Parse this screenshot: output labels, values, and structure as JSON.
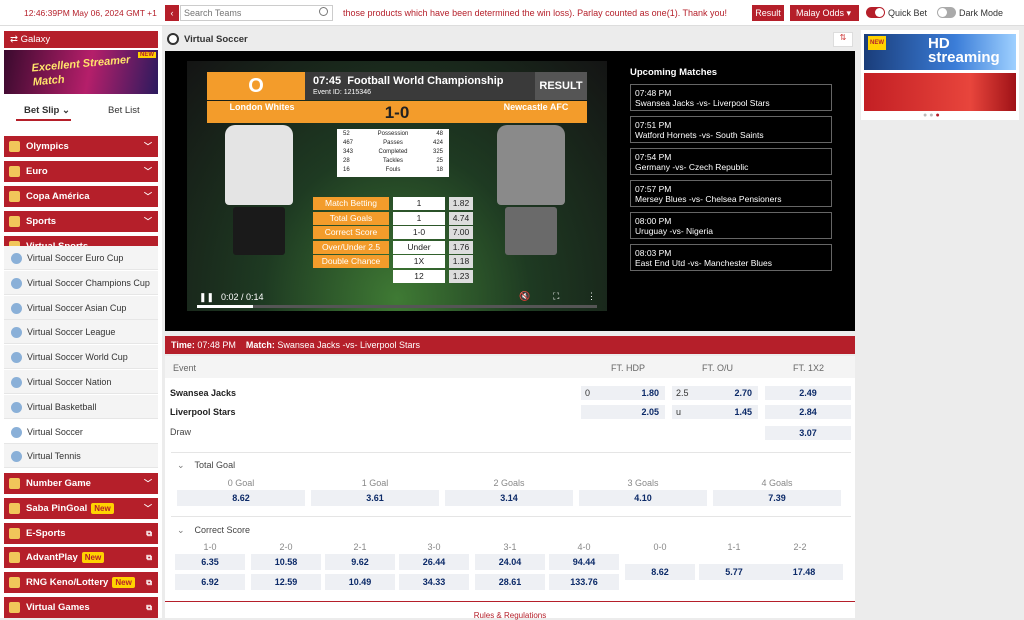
{
  "topbar": {
    "clock": "12:46:39PM May 06, 2024 GMT +1",
    "search_placeholder": "Search Teams",
    "ticker": "those products which have been determined the win loss). Parlay counted as one(1). Thank you!",
    "result_label": "Result",
    "odds_format": "Malay Odds",
    "quick_bet_label": "Quick Bet",
    "dark_mode_label": "Dark Mode",
    "accent": "#b51f2a"
  },
  "sidebar": {
    "galaxy_label": "Galaxy",
    "banner_text": "Excellent Streamer Match",
    "banner_badge": "NEW",
    "bet_slip": "Bet Slip",
    "bet_list": "Bet List",
    "menus_top": [
      {
        "label": "Olympics",
        "icon": "torch-icon"
      },
      {
        "label": "Euro",
        "icon": "trophy-icon"
      },
      {
        "label": "Copa América",
        "icon": "trophy-icon"
      },
      {
        "label": "Sports",
        "icon": "sports-icon"
      },
      {
        "label": "Virtual Sports",
        "icon": "virtual-sports-icon"
      }
    ],
    "virtual_items": [
      "Virtual Soccer Euro Cup",
      "Virtual Soccer Champions Cup",
      "Virtual Soccer Asian Cup",
      "Virtual Soccer League",
      "Virtual Soccer World Cup",
      "Virtual Soccer Nation",
      "Virtual Basketball",
      "Virtual Soccer",
      "Virtual Tennis"
    ],
    "menus_bottom": [
      {
        "label": "Number Game",
        "badge": ""
      },
      {
        "label": "Saba PinGoal",
        "badge": "New"
      },
      {
        "label": "E-Sports",
        "badge": ""
      },
      {
        "label": "AdvantPlay",
        "badge": "New"
      },
      {
        "label": "RNG Keno/Lottery",
        "badge": "New"
      },
      {
        "label": "Virtual Games",
        "badge": ""
      }
    ]
  },
  "header": {
    "title": "Virtual Soccer"
  },
  "video": {
    "logo": "O",
    "clock": "07:45",
    "competition": "Football World Championship",
    "event_id": "Event ID: 1215346",
    "result_label": "RESULT",
    "home": "London Whites",
    "away": "Newcastle AFC",
    "score": "1-0",
    "stats": [
      {
        "l": "52",
        "n": "Possession",
        "r": "48"
      },
      {
        "l": "467",
        "n": "Passes",
        "r": "424"
      },
      {
        "l": "343",
        "n": "Completed",
        "r": "325"
      },
      {
        "l": "28",
        "n": "Tackles",
        "r": "25"
      },
      {
        "l": "16",
        "n": "Fouls",
        "r": "18"
      }
    ],
    "bets": [
      {
        "label": "Match Betting",
        "v1": "1",
        "v2": "1.82"
      },
      {
        "label": "Total Goals",
        "v1": "1",
        "v2": "4.74"
      },
      {
        "label": "Correct Score",
        "v1": "1-0",
        "v2": "7.00"
      },
      {
        "label": "Over/Under 2.5",
        "v1": "Under",
        "v2": "1.76"
      },
      {
        "label": "Double Chance",
        "v1": "1X",
        "v2": "1.18"
      },
      {
        "label": "",
        "v1": "12",
        "v2": "1.23"
      }
    ],
    "time_display": "0:02 / 0:14",
    "progress": 0.14
  },
  "upcoming": {
    "title": "Upcoming Matches",
    "matches": [
      {
        "time": "07:48 PM",
        "teams": "Swansea Jacks -vs- Liverpool Stars"
      },
      {
        "time": "07:51 PM",
        "teams": "Watford Hornets -vs- South Saints"
      },
      {
        "time": "07:54 PM",
        "teams": "Germany -vs- Czech Republic"
      },
      {
        "time": "07:57 PM",
        "teams": "Mersey Blues -vs- Chelsea Pensioners"
      },
      {
        "time": "08:00 PM",
        "teams": "Uruguay -vs- Nigeria"
      },
      {
        "time": "08:03 PM",
        "teams": "East End Utd -vs- Manchester Blues"
      }
    ]
  },
  "right_banner": {
    "badge": "NEW",
    "hd_text": "HD streaming"
  },
  "match": {
    "time_label": "Time:",
    "time": "07:48 PM",
    "match_label": "Match:",
    "teams": "Swansea Jacks -vs- Liverpool Stars",
    "columns": [
      "Event",
      "FT. HDP",
      "FT. O/U",
      "FT. 1X2"
    ],
    "home": "Swansea Jacks",
    "away": "Liverpool Stars",
    "draw": "Draw",
    "hdp": {
      "line": "0",
      "home": "1.80",
      "away": "2.05"
    },
    "ou": {
      "line": "2.5",
      "over": "2.70",
      "under_line": "u",
      "under": "1.45"
    },
    "x12": {
      "home": "2.49",
      "away": "2.84",
      "draw": "3.07"
    }
  },
  "total_goal": {
    "title": "Total Goal",
    "labels": [
      "0 Goal",
      "1 Goal",
      "2 Goals",
      "3 Goals",
      "4 Goals"
    ],
    "values": [
      "8.62",
      "3.61",
      "3.14",
      "4.10",
      "7.39"
    ]
  },
  "correct_score": {
    "title": "Correct Score",
    "labels": [
      "1-0",
      "2-0",
      "2-1",
      "3-0",
      "3-1",
      "4-0",
      "0-0",
      "1-1",
      "2-2"
    ],
    "row1": [
      "6.35",
      "10.58",
      "9.62",
      "26.44",
      "24.04",
      "94.44"
    ],
    "row2": [
      "6.92",
      "12.59",
      "10.49",
      "34.33",
      "28.61",
      "133.76"
    ],
    "draws": [
      "8.62",
      "5.77",
      "17.48"
    ]
  },
  "rules": "Rules & Regulations"
}
